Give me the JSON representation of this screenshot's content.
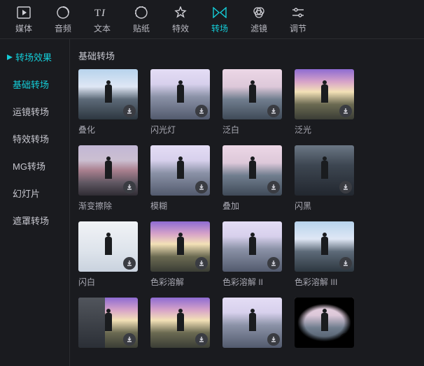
{
  "toolbar": [
    {
      "id": "media",
      "label": "媒体",
      "icon": "media",
      "active": false
    },
    {
      "id": "audio",
      "label": "音频",
      "icon": "audio",
      "active": false
    },
    {
      "id": "text",
      "label": "文本",
      "icon": "text",
      "active": false
    },
    {
      "id": "sticker",
      "label": "贴纸",
      "icon": "sticker",
      "active": false
    },
    {
      "id": "effect",
      "label": "特效",
      "icon": "effect",
      "active": false
    },
    {
      "id": "transition",
      "label": "转场",
      "icon": "transition",
      "active": true
    },
    {
      "id": "filter",
      "label": "滤镜",
      "icon": "filter",
      "active": false
    },
    {
      "id": "adjust",
      "label": "调节",
      "icon": "adjust",
      "active": false
    }
  ],
  "sidebar": {
    "header": "转场效果",
    "items": [
      {
        "label": "基础转场",
        "active": true
      },
      {
        "label": "运镜转场",
        "active": false
      },
      {
        "label": "特效转场",
        "active": false
      },
      {
        "label": "MG转场",
        "active": false
      },
      {
        "label": "幻灯片",
        "active": false
      },
      {
        "label": "遮罩转场",
        "active": false
      }
    ]
  },
  "section_title": "基础转场",
  "thumbs": [
    {
      "label": "叠化",
      "look": "sky-a"
    },
    {
      "label": "闪光灯",
      "look": "sky-b"
    },
    {
      "label": "泛白",
      "look": "sky-c"
    },
    {
      "label": "泛光",
      "look": "sky-d"
    },
    {
      "label": "渐变擦除",
      "look": "sky-e"
    },
    {
      "label": "模糊",
      "look": "sky-b"
    },
    {
      "label": "叠加",
      "look": "sky-c"
    },
    {
      "label": "闪黑",
      "look": "dark"
    },
    {
      "label": "闪白",
      "look": "white"
    },
    {
      "label": "色彩溶解",
      "look": "sky-d"
    },
    {
      "label": "色彩溶解 II",
      "look": "sky-b"
    },
    {
      "label": "色彩溶解 III",
      "look": "sky-a"
    },
    {
      "label": "",
      "look": "sky-d half"
    },
    {
      "label": "",
      "look": "sky-d"
    },
    {
      "label": "",
      "look": "sky-b"
    },
    {
      "label": "",
      "look": "sky-c vignette"
    }
  ],
  "icons": {
    "download": "download-icon"
  }
}
